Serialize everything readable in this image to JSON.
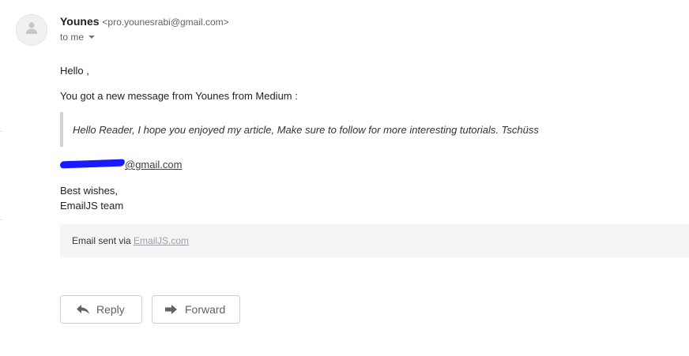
{
  "sender": {
    "name": "Younes",
    "email": "<pro.younesrabi@gmail.com>"
  },
  "recipient": {
    "label": "to me"
  },
  "message": {
    "greeting": "Hello ,",
    "intro": "You got a new message from Younes from Medium :",
    "quote": "Hello Reader, I hope you enjoyed my article, Make sure to follow for more interesting tutorials. Tschüss",
    "contact_email_suffix": "@gmail.com",
    "signoff": "Best wishes,",
    "signature": "EmailJS team"
  },
  "footer": {
    "prefix": "Email sent via ",
    "link_text": "EmailJS.com"
  },
  "actions": {
    "reply_label": "Reply",
    "forward_label": "Forward"
  },
  "icons": {
    "avatar": "person-icon",
    "recipient_details": "chevron-down-icon",
    "reply": "reply-arrow-icon",
    "forward": "forward-arrow-icon"
  },
  "colors": {
    "redaction": "#1a1aff",
    "footer_background": "#f5f5f5",
    "quote_bar": "#d3d3d3",
    "button_border": "#cfcfcf"
  }
}
